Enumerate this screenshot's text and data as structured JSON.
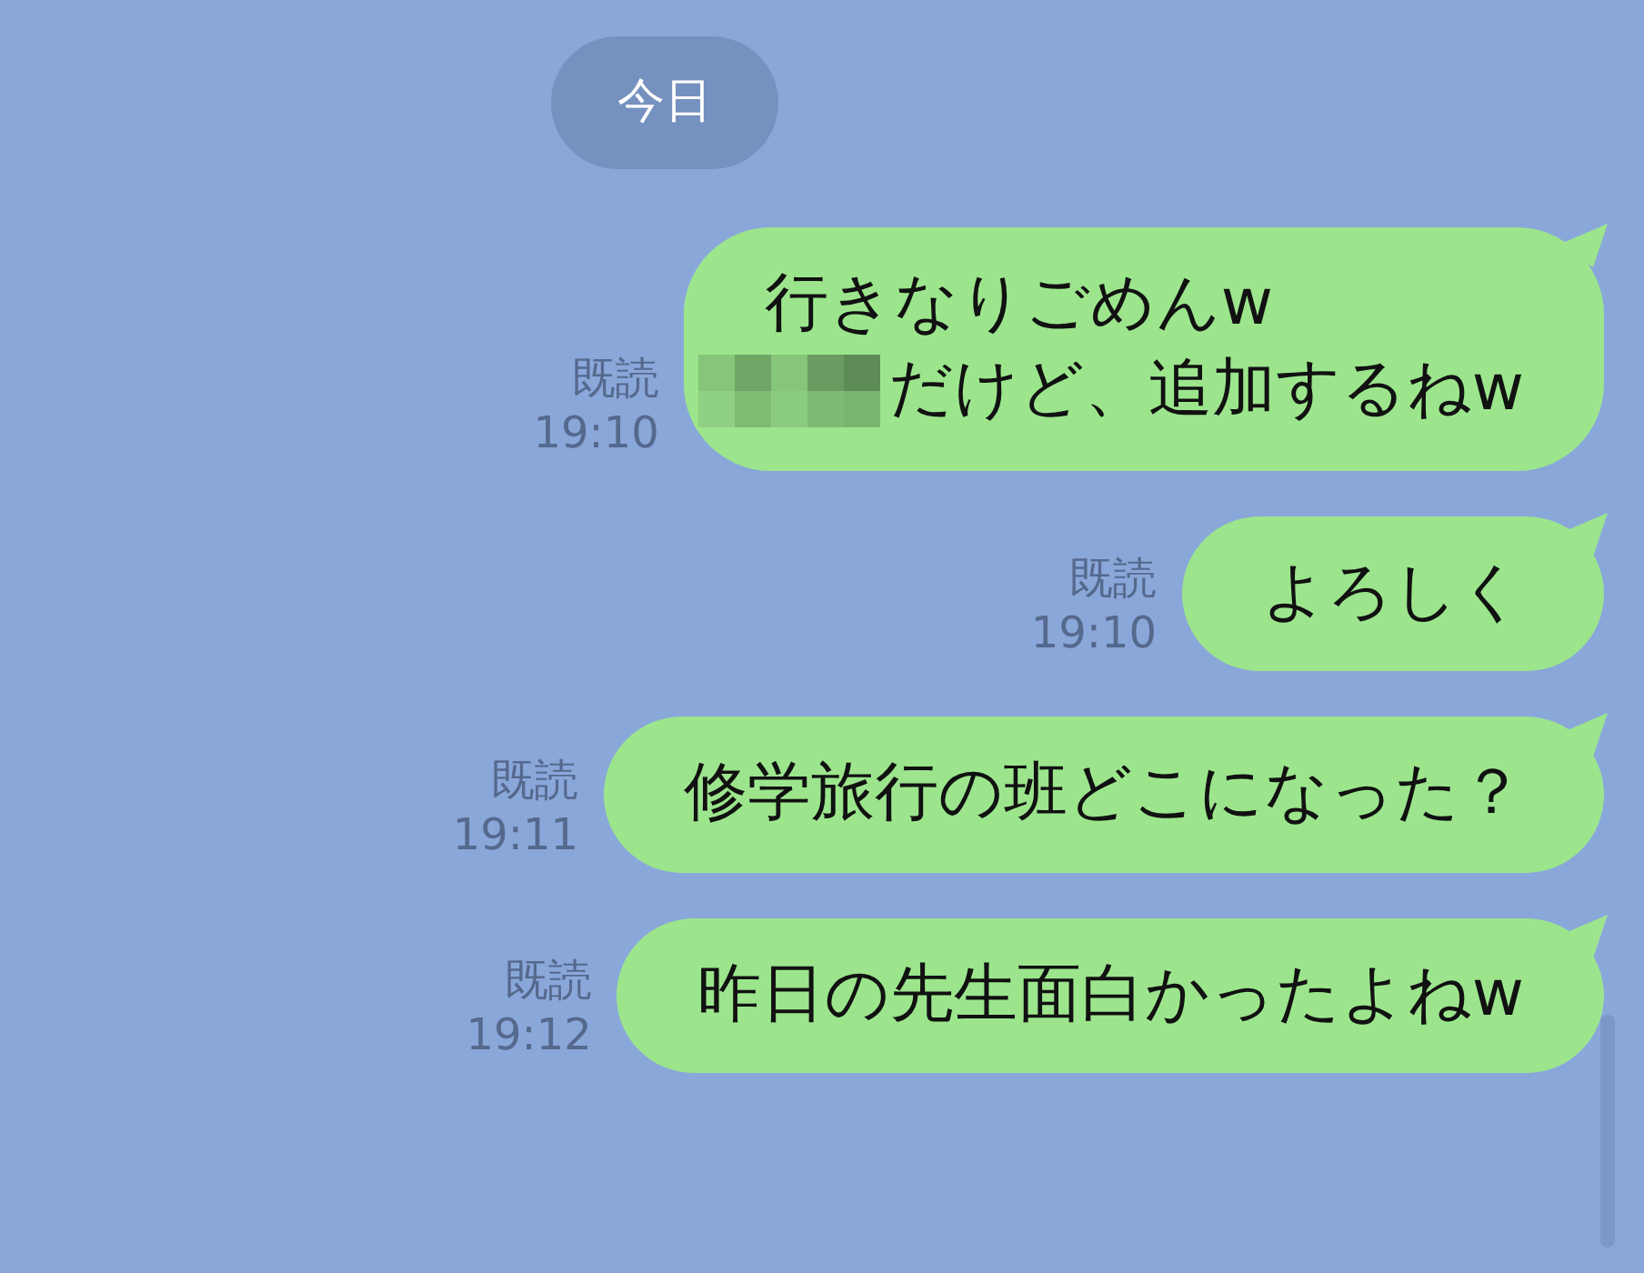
{
  "date_divider": "今日",
  "messages": [
    {
      "read_label": "既読",
      "time": "19:10",
      "lines": [
        {
          "text": "行きなりごめんw",
          "redacted_prefix": false
        },
        {
          "text": "だけど、追加するねw",
          "redacted_prefix": true
        }
      ]
    },
    {
      "read_label": "既読",
      "time": "19:10",
      "lines": [
        {
          "text": "よろしく",
          "redacted_prefix": false
        }
      ]
    },
    {
      "read_label": "既読",
      "time": "19:11",
      "lines": [
        {
          "text": "修学旅行の班どこになった？",
          "redacted_prefix": false
        }
      ]
    },
    {
      "read_label": "既読",
      "time": "19:12",
      "lines": [
        {
          "text": "昨日の先生面白かったよねw",
          "redacted_prefix": false
        }
      ]
    }
  ]
}
